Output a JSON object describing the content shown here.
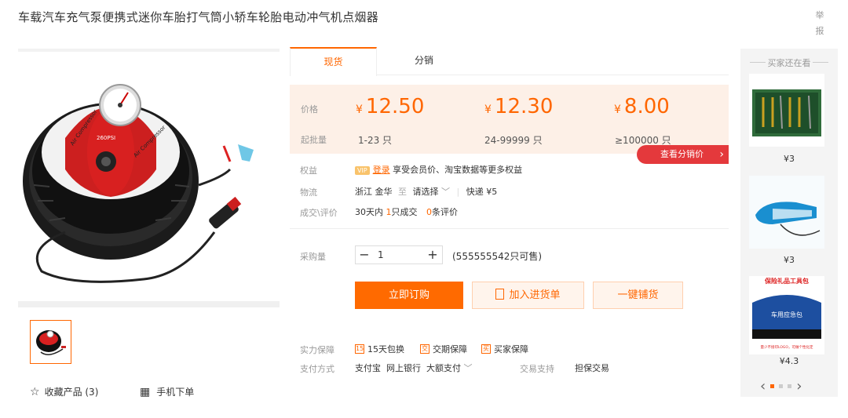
{
  "product": {
    "title": "车载汽车充气泵便携式迷你车胎打气筒小轿车轮胎电动冲气机点烟器",
    "report": "举报",
    "gauge_text": "260PSI",
    "brand_text": "Air Compressor"
  },
  "tabs": [
    {
      "label": "现货"
    },
    {
      "label": "分销"
    }
  ],
  "price": {
    "label": "价格",
    "qty_label": "起批量",
    "currency": "¥",
    "tiers": [
      {
        "price": "12.50",
        "qty": "1-23 只"
      },
      {
        "price": "12.30",
        "qty": "24-99999 只"
      },
      {
        "price": "8.00",
        "qty": "≥100000 只"
      }
    ],
    "dist_button": "查看分销价",
    "dist_arrow": "›"
  },
  "rights": {
    "label": "权益",
    "vip": "VIP",
    "login": "登录",
    "text": "享受会员价、淘宝数据等更多权益"
  },
  "logistics": {
    "label": "物流",
    "from": "浙江 金华",
    "to_word": "至",
    "select": "请选择",
    "chevron": "﹀",
    "express": "快递 ¥5"
  },
  "deals": {
    "label": "成交\\评价",
    "prefix": "30天内",
    "count": "1",
    "unit": "只成交",
    "reviews": "0",
    "reviews_unit": "条评价"
  },
  "purchase": {
    "label": "采购量",
    "minus": "−",
    "value": "1",
    "plus": "+",
    "stock": "(555555542只可售)"
  },
  "buttons": {
    "order": "立即订购",
    "cart": "加入进货单",
    "distribute": "一键铺货"
  },
  "guarantee": {
    "label": "实力保障",
    "items": [
      {
        "icon": "15",
        "text": "15天包换"
      },
      {
        "icon": "交",
        "text": "交期保障"
      },
      {
        "icon": "买",
        "text": "买家保障"
      }
    ]
  },
  "payment": {
    "label": "支付方式",
    "methods": "支付宝  网上银行  大额支付",
    "chevron": "﹀",
    "trade_label": "交易支持",
    "trade_value": "担保交易"
  },
  "gallery_footer": {
    "fav_icon": "☆",
    "fav": "收藏产品 (3)",
    "mobile_icon": "▦",
    "mobile": "手机下单"
  },
  "sidebar": {
    "title": "买家还在看",
    "items": [
      {
        "price": "¥3"
      },
      {
        "price": "¥3"
      },
      {
        "price": "¥4.3",
        "banner": "保险礼品工具包",
        "bag_text": "车用应急包",
        "caption": "量少不接印LOGO，可做个性化定"
      }
    ],
    "prev": "‹",
    "next": "›"
  },
  "colors": {
    "accent": "#ff6a00",
    "price_bg": "#fdf0e7",
    "dist_red": "#e4393c"
  }
}
